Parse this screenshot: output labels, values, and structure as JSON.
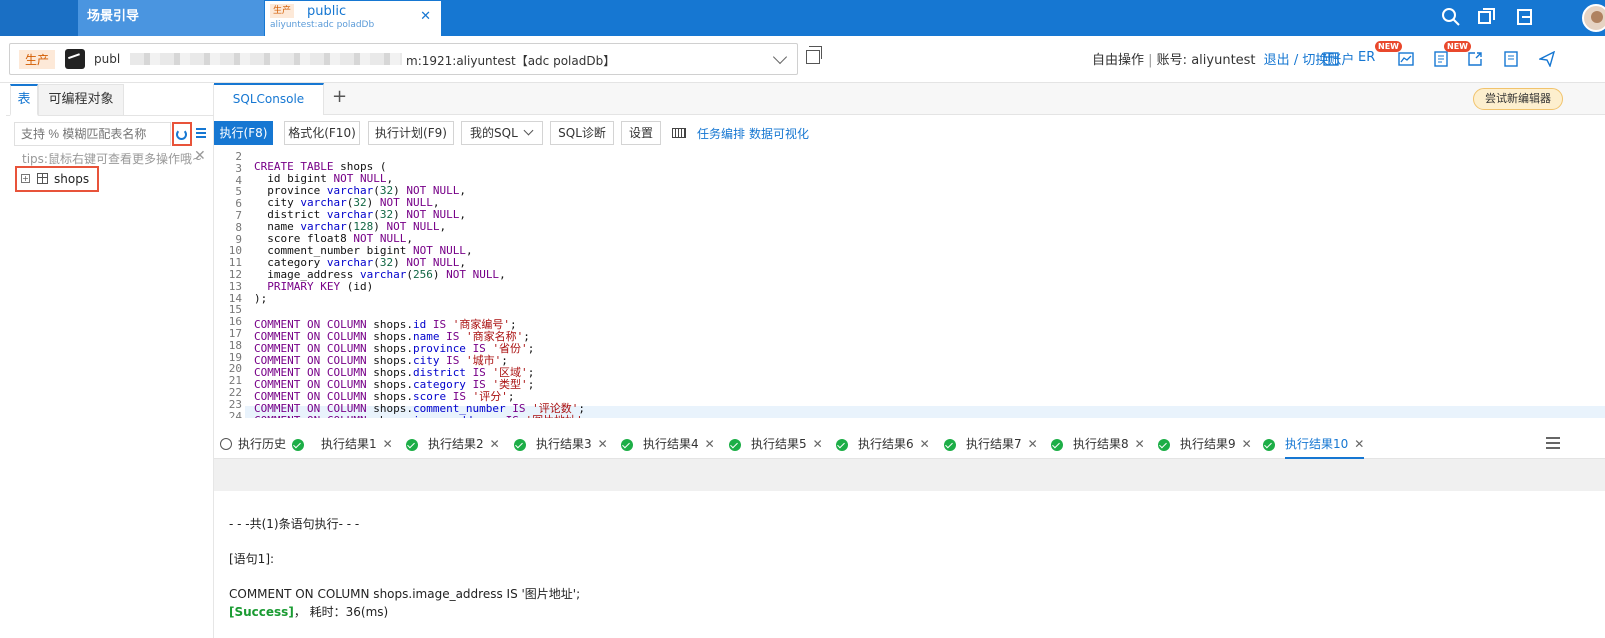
{
  "topbar": {
    "guide_tab": "场景引导",
    "active_tab": {
      "env": "生产",
      "title": "public",
      "subtitle": "aliyuntest:adc poladDb"
    },
    "icons": [
      "search-icon",
      "window-icon",
      "exit-icon",
      "avatar"
    ]
  },
  "connection": {
    "env": "生产",
    "prefix": "publ",
    "suffix": "m:1921:aliyuntest【adc poladDb】",
    "mode": "自由操作",
    "account_label": "账号:",
    "account": "aliyuntest",
    "logout": "退出",
    "switch": "切换账户",
    "er": "ER",
    "badge": "NEW"
  },
  "left": {
    "tab_table": "表",
    "tab_programmable": "可编程对象",
    "search_placeholder": "支持 % 模糊匹配表名称",
    "tips": "tips:鼠标右键可查看更多操作哦~",
    "tables": [
      "shops"
    ]
  },
  "editor_tabs": {
    "console": "SQLConsole",
    "try_new": "尝试新编辑器"
  },
  "toolbar": {
    "run": "执行(F8)",
    "format": "格式化(F10)",
    "plan": "执行计划(F9)",
    "my_sql": "我的SQL",
    "diag": "SQL诊断",
    "settings": "设置",
    "schedule": "任务编排",
    "visual": "数据可视化"
  },
  "code": {
    "line_numbers": [
      "2",
      "3",
      "4",
      "5",
      "6",
      "7",
      "8",
      "9",
      "10",
      "11",
      "12",
      "13",
      "14",
      "15",
      "16",
      "17",
      "18",
      "19",
      "20",
      "21",
      "22",
      "23",
      "24"
    ]
  },
  "results": {
    "history": "执行历史",
    "tabs": [
      "执行结果1",
      "执行结果2",
      "执行结果3",
      "执行结果4",
      "执行结果5",
      "执行结果6",
      "执行结果7",
      "执行结果8",
      "执行结果9",
      "执行结果10"
    ],
    "summary": "- - -共(1)条语句执行- - -",
    "stmt_label": "[语句1]:",
    "stmt": "COMMENT ON COLUMN shops.image_address IS '图片地址';",
    "success": "[Success]",
    "time": "，  耗时：36(ms)"
  },
  "colors": {
    "brand": "#1677d2",
    "highlight_box": "#e8533a",
    "success": "#1dae47"
  }
}
